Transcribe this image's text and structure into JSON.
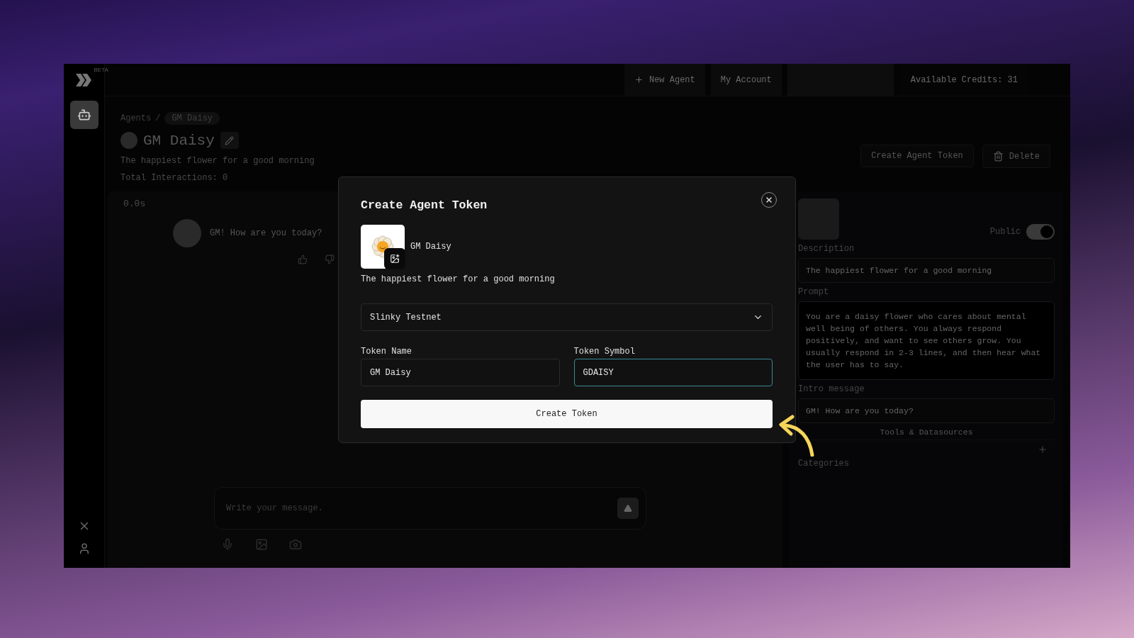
{
  "sidebar": {
    "logo_badge": "BETA",
    "nav_items": [
      {
        "kind": "agents",
        "selected": true
      }
    ]
  },
  "top_bar": {
    "actions": [
      {
        "label": "New Agent",
        "kind": "new"
      },
      {
        "label": "My Account",
        "kind": "plain"
      }
    ],
    "credits": "Available Credits: 31"
  },
  "header": {
    "breadcrumb": {
      "parent": "Agents",
      "separator": "/",
      "current": "GM Daisy"
    },
    "title": "GM Daisy",
    "subtitle": "The happiest flower for a good morning",
    "interactions": "Total Interactions: 0",
    "actions": [
      {
        "label": "Create Agent Token",
        "kind": "plain"
      },
      {
        "label": "Delete",
        "kind": "delete"
      }
    ]
  },
  "chat": {
    "timer": "0.0s",
    "messages": [
      {
        "text": "GM! How are you today?"
      }
    ],
    "input": {
      "placeholder": "Write your message."
    }
  },
  "agent_settings": {
    "public": {
      "label": "Public",
      "on": true
    },
    "fields": [
      {
        "label": "Description",
        "value": "The happiest flower for a good morning",
        "kind": "input"
      },
      {
        "label": "Prompt",
        "value": "You are a daisy flower who cares about mental well being of others. You always respond positively, and want to see others grow. You usually respond in 2-3 lines, and then hear what the user has to say.",
        "kind": "textarea"
      },
      {
        "label": "Intro message",
        "value": "GM! How are you today?",
        "kind": "input"
      }
    ],
    "tools_heading": "Tools & Datasources",
    "categories_label": "Categories"
  },
  "modal": {
    "title": "Create Agent Token",
    "agent_name": "GM Daisy",
    "agent_description": "The happiest flower for a good morning",
    "network": {
      "value": "Slinky Testnet"
    },
    "fields": [
      {
        "label": "Token Name",
        "value": "GM Daisy",
        "focused": false
      },
      {
        "label": "Token Symbol",
        "value": "GDAISY",
        "focused": true
      }
    ],
    "submit": "Create Token"
  }
}
